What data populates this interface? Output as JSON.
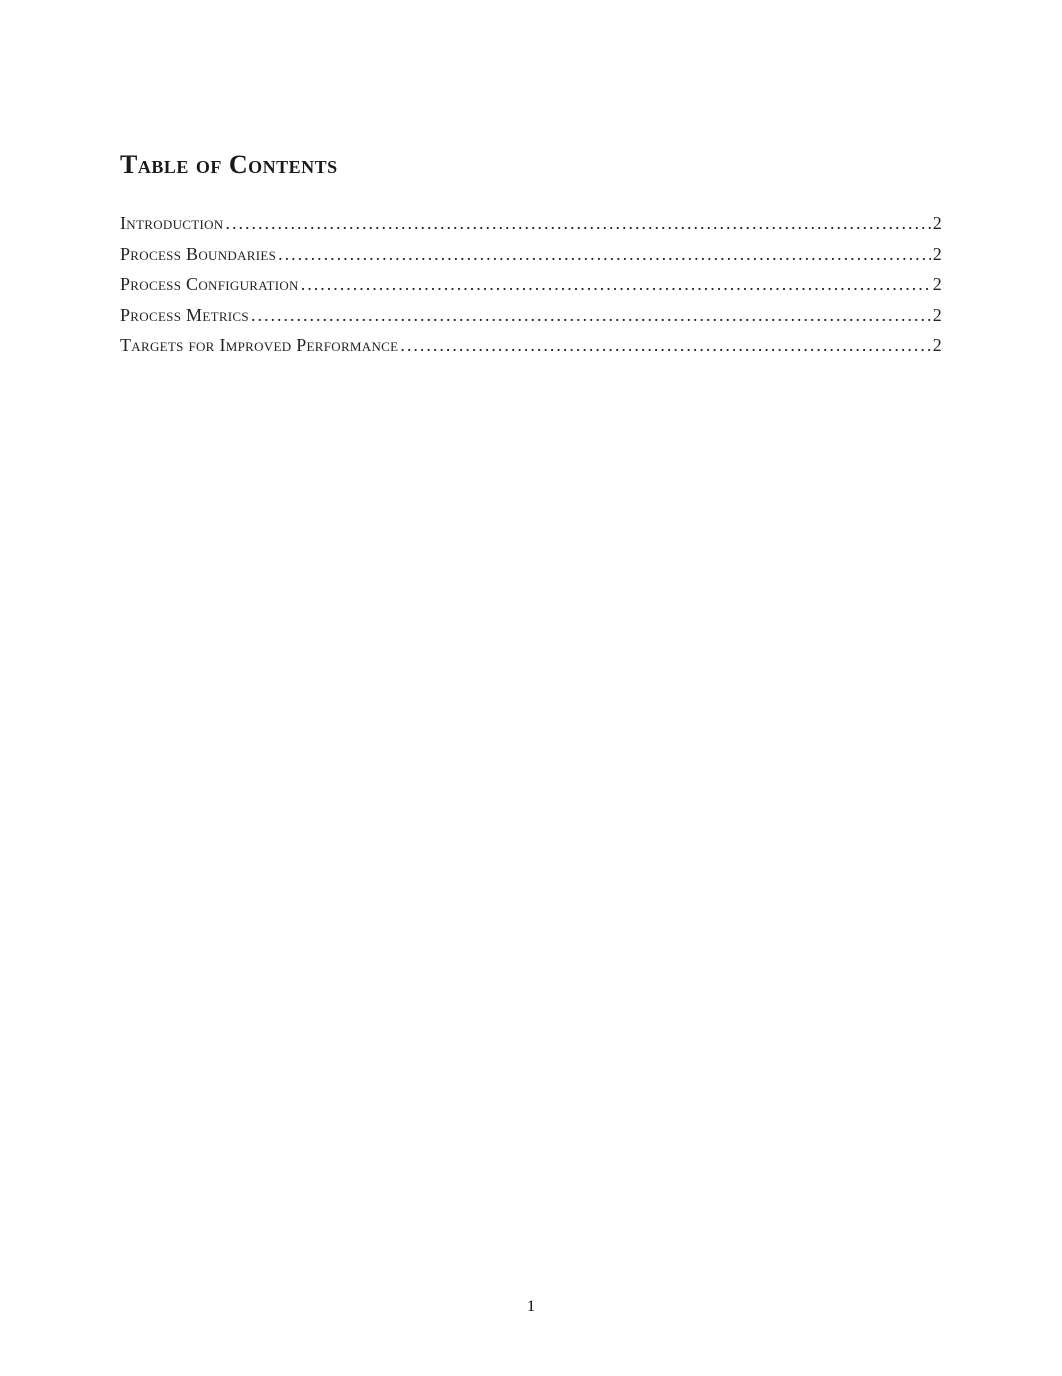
{
  "title": "Table of Contents",
  "toc": {
    "entries": [
      {
        "label": "Introduction",
        "page": "2"
      },
      {
        "label": "Process Boundaries",
        "page": "2"
      },
      {
        "label": "Process Configuration",
        "page": "2"
      },
      {
        "label": "Process Metrics",
        "page": "2"
      },
      {
        "label": "Targets for Improved Performance",
        "page": "2"
      }
    ]
  },
  "pageNumber": "1"
}
